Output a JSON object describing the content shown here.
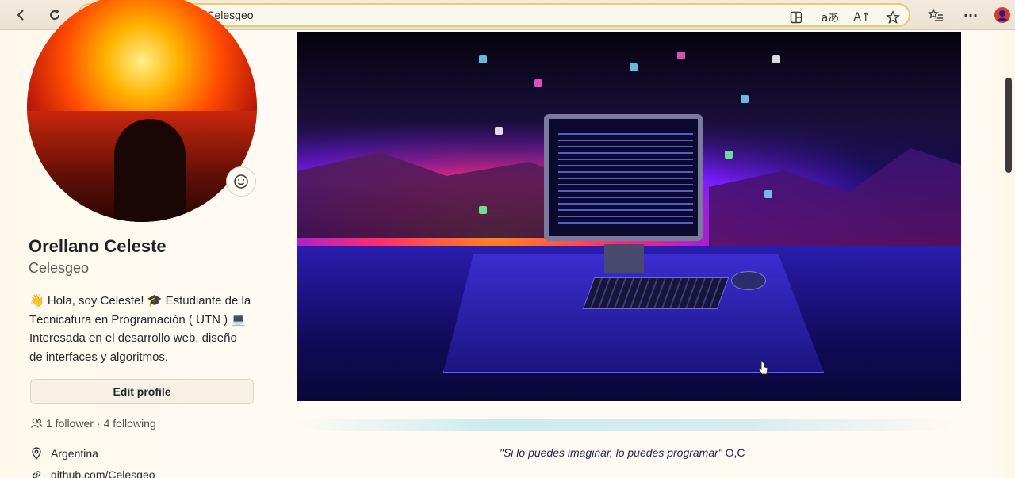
{
  "browser": {
    "url": "https://github.com/Celesgeo",
    "back_icon": "back-arrow-icon",
    "refresh_icon": "refresh-icon",
    "lock_icon": "lock-icon",
    "toolbar_icons": [
      "split-screen-icon",
      "translate-icon",
      "read-aloud-icon",
      "favorite-star-icon",
      "favorites-list-icon",
      "more-icon",
      "profile-icon"
    ],
    "translate_glyph": "aあ",
    "read_aloud_glyph": "A↑",
    "more_glyph": "···"
  },
  "profile": {
    "name": "Orellano Celeste",
    "username": "Celesgeo",
    "bio_lines": [
      "👋 Hola, soy Celeste! 🎓 Estudiante de la",
      "Técnicatura en Programación ( UTN ) 💻",
      "Interesada en el desarrollo web, diseño",
      "de interfaces y algoritmos."
    ],
    "edit_button": "Edit profile",
    "followers_text": "1 follower",
    "separator": "·",
    "following_text": "4 following",
    "location": "Argentina",
    "website": "github.com/Celesgeo"
  },
  "readme": {
    "quote": "\"Si lo puedes imaginar, lo puedes programar\"",
    "signature": "O,C"
  },
  "colors": {
    "address_border": "#e2cf6a",
    "accent_banner": "#7a1cff"
  }
}
